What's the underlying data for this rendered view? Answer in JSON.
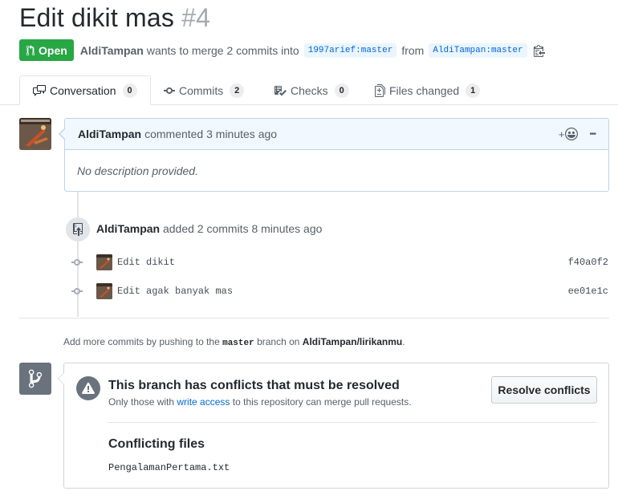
{
  "pr": {
    "title": "Edit dikit mas",
    "number": "#4",
    "state": "Open",
    "author": "AldiTampan",
    "merge_text": "wants to merge 2 commits into",
    "base_branch": "1997arief:master",
    "from_text": "from",
    "head_branch": "AldiTampan:master"
  },
  "tabs": [
    {
      "label": "Conversation",
      "count": "0",
      "icon": "comment-discussion-icon"
    },
    {
      "label": "Commits",
      "count": "2",
      "icon": "git-commit-icon"
    },
    {
      "label": "Checks",
      "count": "0",
      "icon": "checklist-icon"
    },
    {
      "label": "Files changed",
      "count": "1",
      "icon": "file-diff-icon"
    }
  ],
  "comment": {
    "author": "AldiTampan",
    "meta": "commented 3 minutes ago",
    "body": "No description provided.",
    "reaction_label": "+",
    "menu_label": "•••"
  },
  "event": {
    "author": "AldiTampan",
    "text": "added 2 commits 8 minutes ago"
  },
  "commits": [
    {
      "message": "Edit dikit",
      "sha": "f40a0f2"
    },
    {
      "message": "Edit agak banyak mas",
      "sha": "ee01e1c"
    }
  ],
  "hint": {
    "prefix": "Add more commits by pushing to the",
    "branch": "master",
    "middle": "branch on",
    "repo": "AldiTampan/lirikanmu",
    "suffix": "."
  },
  "merge": {
    "title": "This branch has conflicts that must be resolved",
    "sub_prefix": "Only those with",
    "sub_link": "write access",
    "sub_suffix": "to this repository can merge pull requests.",
    "resolve_button": "Resolve conflicts",
    "files_title": "Conflicting files",
    "files": [
      "PengalamanPertama.txt"
    ]
  },
  "colors": {
    "open_green": "#28a745",
    "link_blue": "#0366d6",
    "comment_header_bg": "#f1f8ff"
  }
}
